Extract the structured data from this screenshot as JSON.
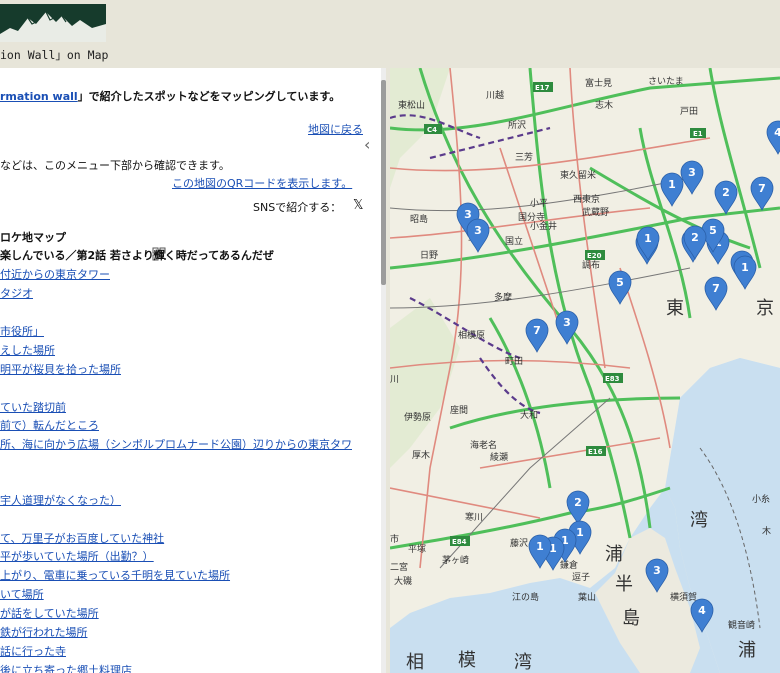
{
  "header": {
    "subtitle": "ion Wall」on Map"
  },
  "sidebar": {
    "collapse_glyph": "‹",
    "intro_link": "rmation wall",
    "intro_rest": "」で紹介したスポットなどをマッピングしています。",
    "back_link": "地図に戻る",
    "menu_note": "などは、このメニュー下部から確認できます。",
    "qr_link": "この地図のQRコードを表示します。",
    "sns_label": "SNSで紹介する：",
    "x_glyph": "𝕏",
    "section_title": "ロケ地マップ",
    "episode_title": "楽しんでいる／第2話 若さより輝く時だってあるんだぜ",
    "items": [
      "付近からの東京タワー",
      "タジオ",
      "市役所」",
      "えした場所",
      "明平が桜貝を拾った場所",
      "ていた踏切前",
      "前で）転んだところ",
      "所、海に向かう広場（シンボルプロムナード公園）辺りからの東京タワ",
      "宇人道理がなくなった）",
      "て、万里子がお百度していた神社",
      "平が歩いていた場所（出勤？）",
      "上がり、電車に乗っている千明を見ていた場所",
      "いて場所",
      "が話をしていた場所",
      "鉄が行われた場所",
      "話に行った寺",
      "後に立ち寄った郷土料理店"
    ]
  },
  "map": {
    "labels": [
      "さいたま",
      "富士見",
      "川越",
      "志木",
      "戸田",
      "所沢",
      "三芳",
      "東久留米",
      "西東京",
      "小平",
      "国分寺",
      "武蔵野",
      "昭島",
      "国立",
      "立川",
      "日野",
      "小金井",
      "多摩",
      "相模原",
      "町田",
      "調布",
      "東",
      "京",
      "大和",
      "海老名",
      "綾瀬",
      "座間",
      "寒川",
      "平塚",
      "茅ヶ崎",
      "藤沢",
      "江の島",
      "浦",
      "半",
      "島",
      "鎌倉",
      "葉山",
      "逗子",
      "横須賀",
      "湾",
      "浦",
      "相",
      "模",
      "湾",
      "川",
      "市",
      "厚木",
      "東松山",
      "伊勢原",
      "大磯",
      "二宮",
      "観音崎",
      "小糸",
      "木"
    ],
    "markers": [
      {
        "n": "1"
      },
      {
        "n": "3"
      },
      {
        "n": "2"
      },
      {
        "n": "7"
      },
      {
        "n": "3"
      },
      {
        "n": "3"
      },
      {
        "n": "1"
      },
      {
        "n": "2"
      },
      {
        "n": "1"
      },
      {
        "n": "5"
      },
      {
        "n": "1"
      },
      {
        "n": "1"
      },
      {
        "n": "2"
      },
      {
        "n": "1"
      },
      {
        "n": "7"
      },
      {
        "n": "5"
      },
      {
        "n": "7"
      },
      {
        "n": "3"
      },
      {
        "n": "2"
      },
      {
        "n": "1"
      },
      {
        "n": "1"
      },
      {
        "n": "1"
      },
      {
        "n": "1"
      },
      {
        "n": "3"
      },
      {
        "n": "4"
      },
      {
        "n": "4"
      }
    ],
    "marker_color": "#3f7fd2",
    "road_green": "#4fbf5a",
    "road_red": "#e08a7f",
    "rail_purple": "#5b3b8c",
    "sea_color": "#c9dff0",
    "route_badges": [
      "C4",
      "E17",
      "E20",
      "E83",
      "E84",
      "E16",
      "E1"
    ]
  }
}
